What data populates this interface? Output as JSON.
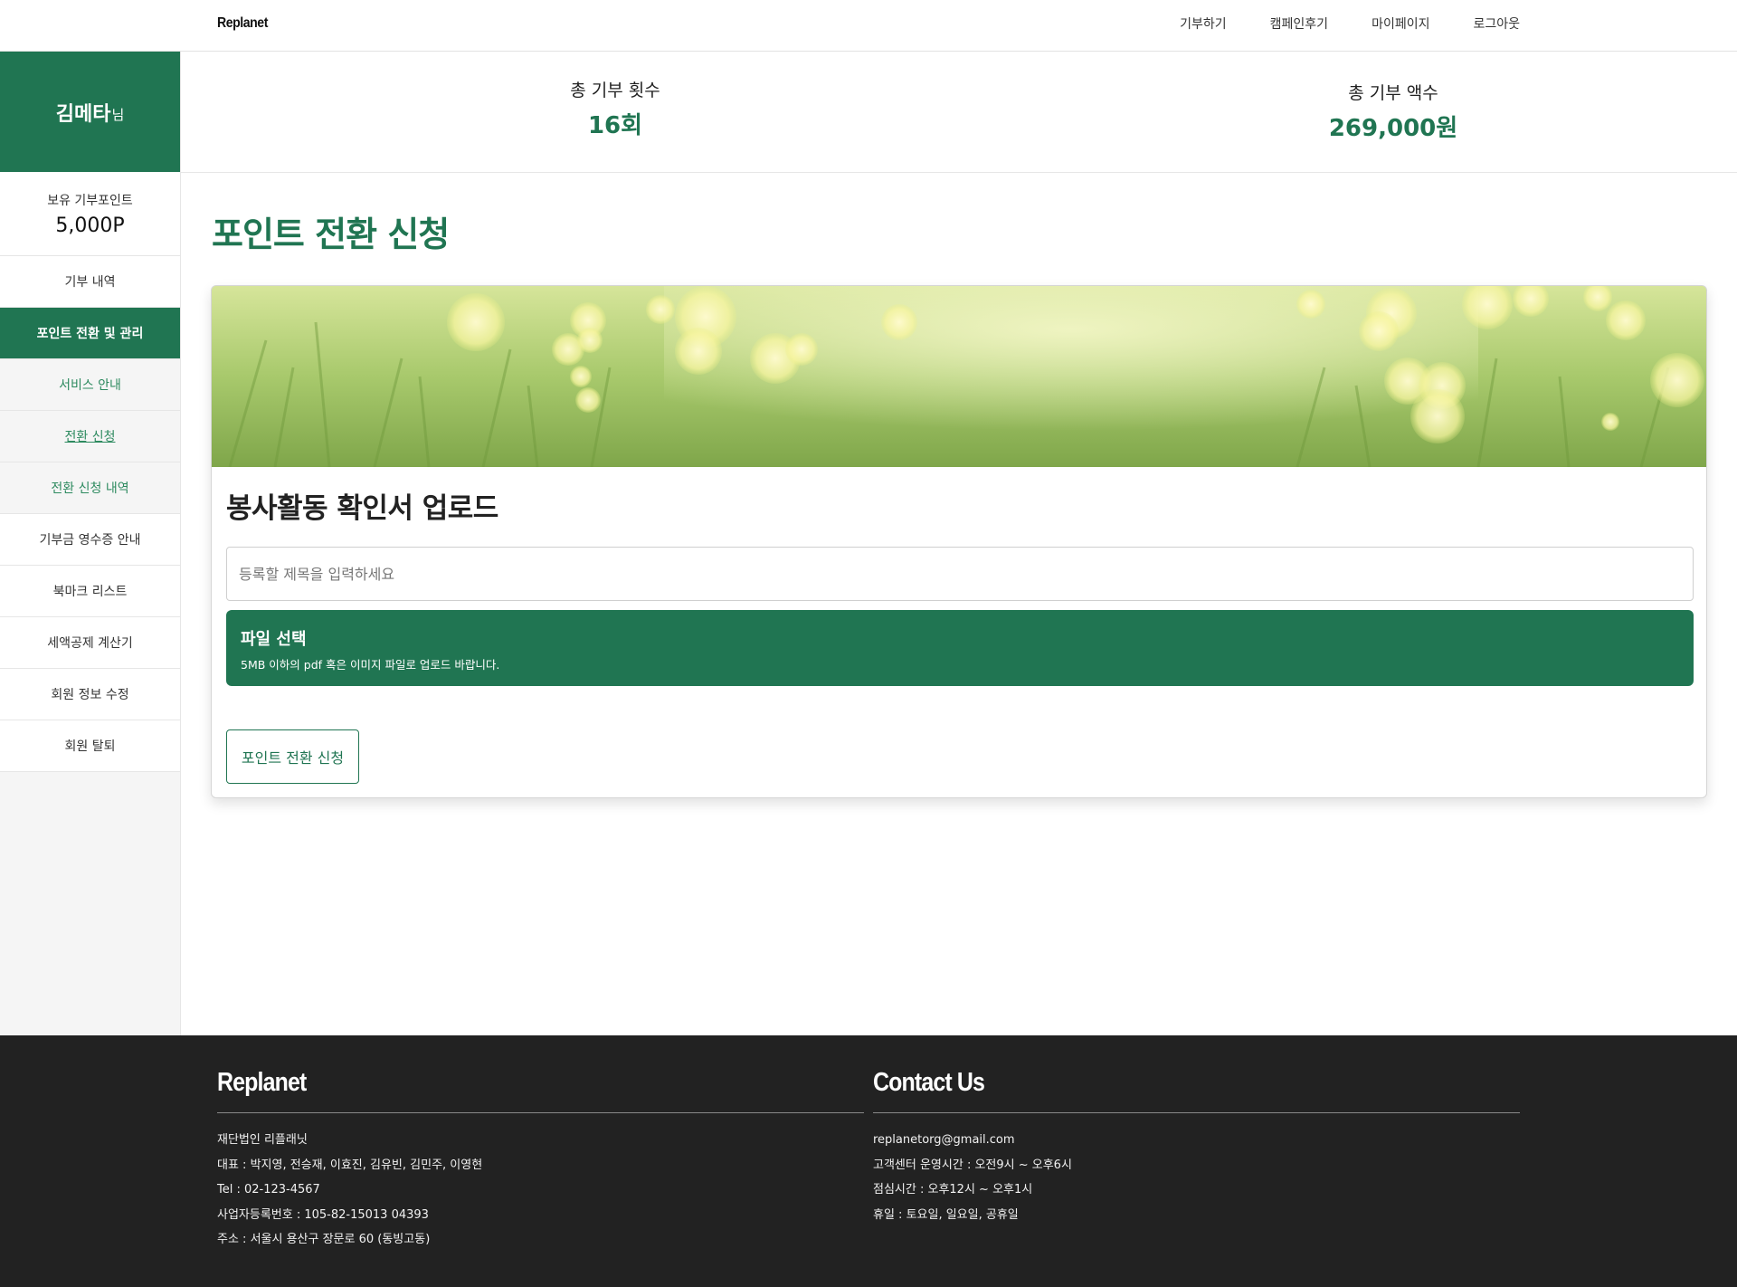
{
  "nav": {
    "brand": "Replanet",
    "links": [
      "기부하기",
      "캠페인후기",
      "마이페이지",
      "로그아웃"
    ]
  },
  "sidebar": {
    "user_name": "김메타",
    "user_suffix": "님",
    "points_label": "보유 기부포인트",
    "points_value": "5,000P",
    "items": [
      {
        "label": "기부 내역"
      },
      {
        "label": "포인트 전환 및 관리"
      },
      {
        "label": "서비스 안내"
      },
      {
        "label": "전환 신청"
      },
      {
        "label": "전환 신청 내역"
      },
      {
        "label": "기부금 영수증 안내"
      },
      {
        "label": "북마크 리스트"
      },
      {
        "label": "세액공제 계산기"
      },
      {
        "label": "회원 정보 수정"
      },
      {
        "label": "회원 탈퇴"
      }
    ]
  },
  "stats": {
    "count_label": "총 기부 횟수",
    "count_value": "16회",
    "amount_label": "총 기부 액수",
    "amount_value": "269,000원"
  },
  "main": {
    "page_title": "포인트 전환 신청",
    "card_title": "봉사활동 확인서 업로드",
    "title_placeholder": "등록할 제목을 입력하세요",
    "file_title": "파일 선택",
    "file_desc": "5MB 이하의 pdf 혹은 이미지 파일로 업로드 바랍니다.",
    "submit_label": "포인트 전환 신청"
  },
  "footer": {
    "left_head": "Replanet",
    "left_lines": [
      "재단법인 리플래닛",
      "대표 : 박지영, 전승재, 이효진, 김유빈, 김민주, 이영현",
      "Tel : 02-123-4567",
      "사업자등록번호 : 105-82-15013 04393",
      "주소 : 서울시 용산구 장문로 60 (동빙고동)"
    ],
    "right_head": "Contact Us",
    "right_lines": [
      "replanetorg@gmail.com",
      "고객센터 운영시간 : 오전9시 ~ 오후6시",
      "점심시간 : 오후12시 ~ 오후1시",
      "휴일 : 토요일, 일요일, 공휴일"
    ]
  },
  "colors": {
    "brand_green": "#207552",
    "sub_green": "#2d8a5f",
    "footer_bg": "#222222"
  }
}
